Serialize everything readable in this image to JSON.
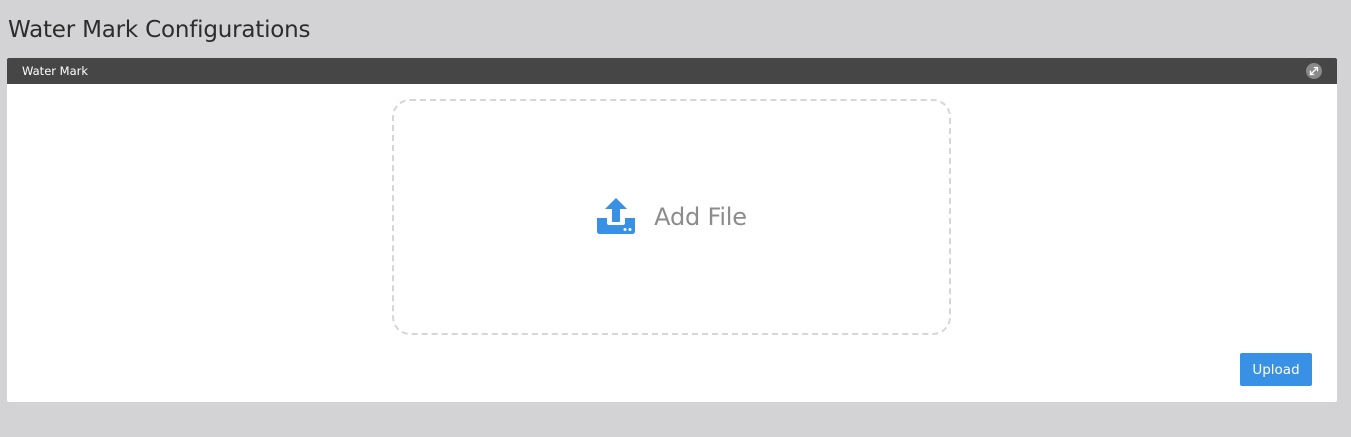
{
  "page": {
    "title": "Water Mark Configurations"
  },
  "panel": {
    "title": "Water Mark",
    "expand_icon": "expand-arrows-icon"
  },
  "dropzone": {
    "icon": "upload-icon",
    "label": "Add File"
  },
  "actions": {
    "upload_label": "Upload"
  },
  "colors": {
    "background": "#d3d3d5",
    "panel_header": "#464646",
    "accent": "#3891e4",
    "dropzone_border": "#d6d6d6",
    "muted_text": "#8c8c8c"
  }
}
